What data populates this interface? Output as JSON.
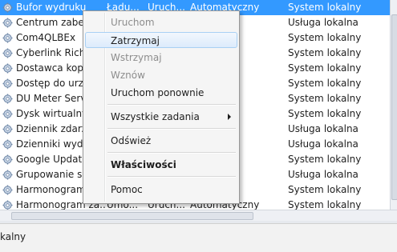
{
  "services": [
    {
      "name": "Bufor wydruku",
      "desc": "Ładu...",
      "status": "Uruch...",
      "startup": "Automatyczny",
      "logon": "System lokalny",
      "selected": true
    },
    {
      "name": "Centrum zabezp",
      "desc": "",
      "status": "",
      "startup": "",
      "logon": "Usługa lokalna"
    },
    {
      "name": "Com4QLBEx",
      "desc": "",
      "status": "",
      "startup": "",
      "logon": "System lokalny"
    },
    {
      "name": "Cyberlink RichV",
      "desc": "",
      "status": "",
      "startup": "",
      "logon": "System lokalny"
    },
    {
      "name": "Dostawca kopio",
      "desc": "",
      "status": "",
      "startup": "",
      "logon": "System lokalny"
    },
    {
      "name": "Dostęp do urząd",
      "desc": "",
      "status": "",
      "startup": "",
      "logon": "System lokalny"
    },
    {
      "name": "DU Meter Servic",
      "desc": "",
      "status": "",
      "startup": "",
      "logon": "System lokalny"
    },
    {
      "name": "Dysk wirtualny",
      "desc": "",
      "status": "",
      "startup": "",
      "logon": "System lokalny"
    },
    {
      "name": "Dziennik zdarzeń",
      "desc": "",
      "status": "",
      "startup": "",
      "logon": "Usługa lokalna"
    },
    {
      "name": "Dzienniki wydaj",
      "desc": "",
      "status": "",
      "startup": "",
      "logon": "Usługa lokalna"
    },
    {
      "name": "Google Update",
      "desc": "",
      "status": "",
      "startup": "",
      "logon": "System lokalny"
    },
    {
      "name": "Grupowanie sieci",
      "desc": "",
      "status": "",
      "startup": "",
      "logon": "Usługa lokalna"
    },
    {
      "name": "Harmonogram",
      "desc": "",
      "status": "",
      "startup": "",
      "logon": "System lokalny"
    },
    {
      "name": "Harmonogram za...",
      "desc": "Umo...",
      "status": "Uruch...",
      "startup": "Automatyczny",
      "logon": "System lokalny"
    }
  ],
  "context_menu": {
    "items": [
      {
        "label": "Uruchom",
        "state": "disabled"
      },
      {
        "label": "Zatrzymaj",
        "state": "hover"
      },
      {
        "label": "Wstrzymaj",
        "state": "disabled"
      },
      {
        "label": "Wznów",
        "state": "disabled"
      },
      {
        "label": "Uruchom ponownie",
        "state": "normal"
      },
      {
        "label": "Wszystkie zadania",
        "state": "submenu"
      },
      {
        "label": "Odśwież",
        "state": "normal"
      },
      {
        "label": "Właściwości",
        "state": "bold"
      },
      {
        "label": "Pomoc",
        "state": "normal"
      }
    ]
  },
  "statusbar": {
    "text": "kalny"
  },
  "colors": {
    "selection": "#3399ff",
    "menu_bg": "#f5f5f5",
    "disabled_text": "#8d8d8d"
  }
}
